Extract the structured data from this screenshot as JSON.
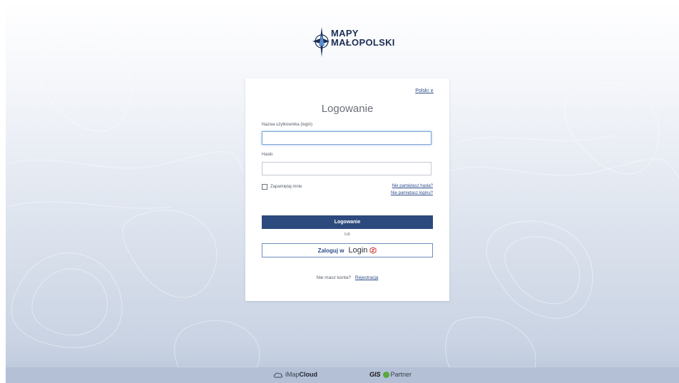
{
  "logo": {
    "line1": "MAPY",
    "line2": "MAŁOPOLSKI",
    "icon": "compass-star-icon"
  },
  "card": {
    "language": "Polski ∨",
    "title": "Logowanie",
    "username_label": "Nazwa użytkownika (login)",
    "username_value": "",
    "password_label": "Hasło",
    "password_value": "",
    "remember_label": "Zapamiętaj mnie",
    "forgot_password": "Nie pamiętasz hasła?",
    "forgot_login": "Nie pamiętasz loginu?",
    "login_button": "Logowanie",
    "or_text": "lub",
    "sso_prefix": "Zaloguj w",
    "sso_name": "Login",
    "no_account": "Nie masz konta?",
    "register_link": "Rejestracja"
  },
  "footer": {
    "brand1_light": "iMap",
    "brand1_bold": "Cloud",
    "brand2_bold": "GIS",
    "brand2_light": "Partner"
  },
  "colors": {
    "primary": "#2c4a7e",
    "link": "#2f4c8a",
    "footer_bg": "#b3c0d6",
    "gis_dot": "#5aa83a",
    "sso_icon": "#d63a3a"
  }
}
